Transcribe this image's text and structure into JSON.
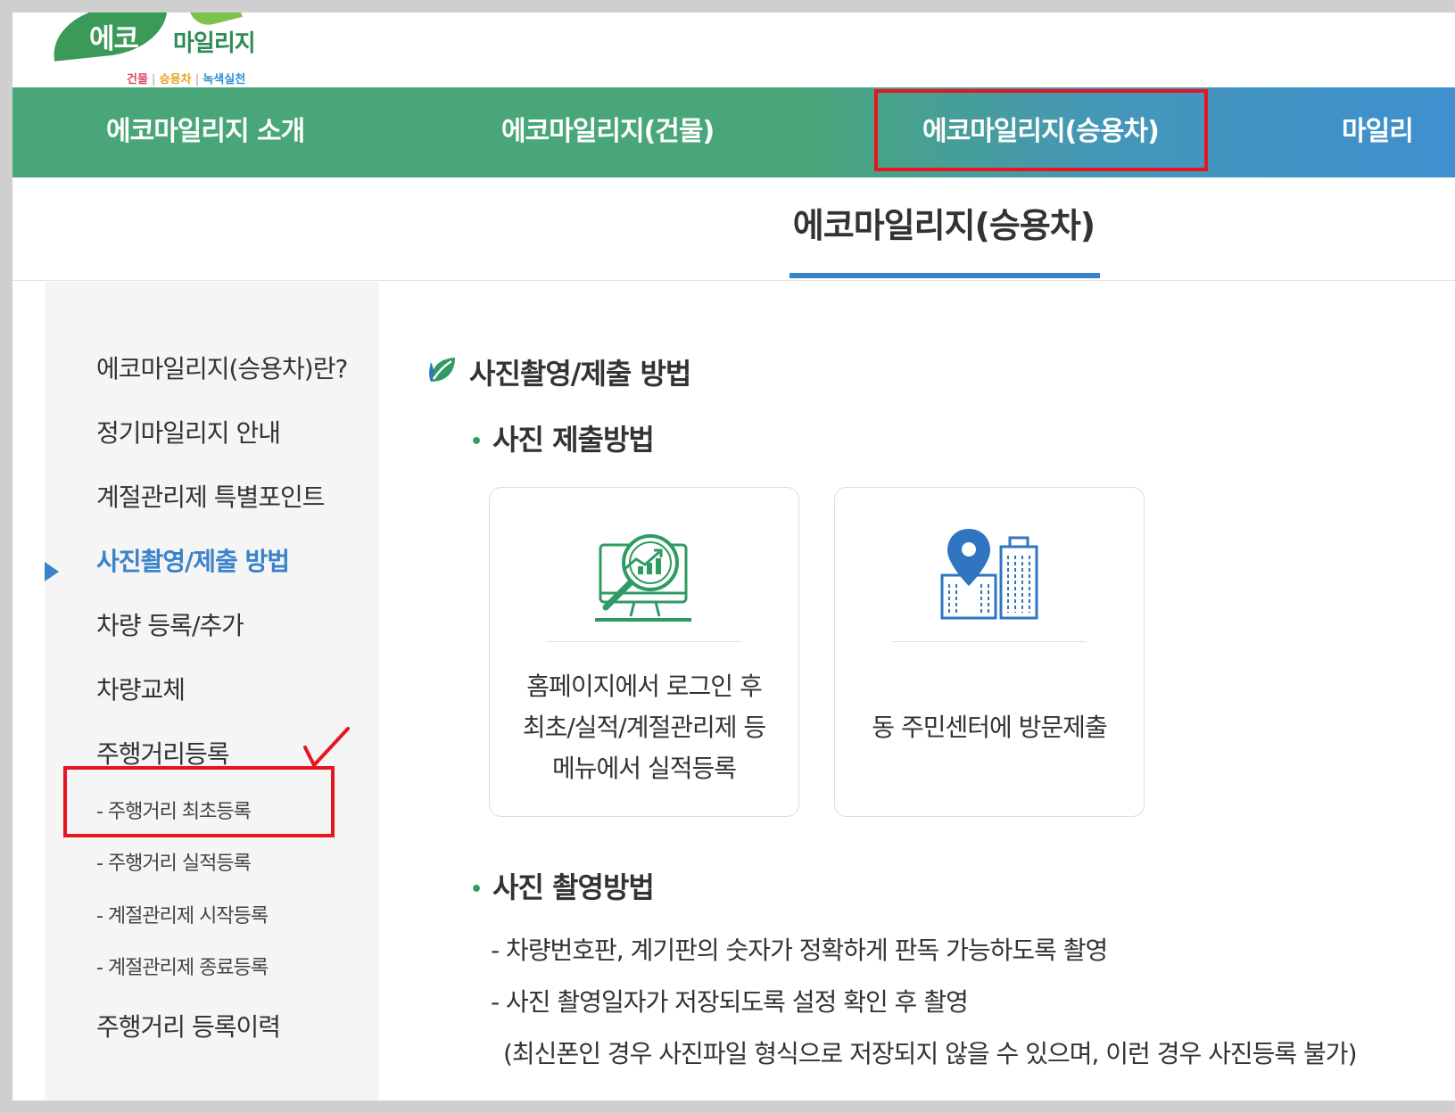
{
  "logo": {
    "brand_main": "에코",
    "brand_sub": "마일리지",
    "tagline_1": "건물",
    "tagline_2": "승용차",
    "tagline_3": "녹색실천",
    "separator": "|",
    "colors": {
      "green": "#3b9a57",
      "red": "#e14a5c",
      "orange": "#e9a21f",
      "blue": "#2b8fd6"
    }
  },
  "topnav": {
    "items": [
      {
        "label": "에코마일리지 소개"
      },
      {
        "label": "에코마일리지(건물)"
      },
      {
        "label": "에코마일리지(승용차)"
      },
      {
        "label": "마일리"
      }
    ],
    "colors": {
      "start": "#48a679",
      "end": "#3f8fd0"
    }
  },
  "page": {
    "title": "에코마일리지(승용차)",
    "accent": "#3a83c8"
  },
  "sidebar": {
    "items": [
      {
        "label": "에코마일리지(승용차)란?"
      },
      {
        "label": "정기마일리지 안내"
      },
      {
        "label": "계절관리제 특별포인트"
      },
      {
        "label": "사진촬영/제출 방법",
        "active": true
      },
      {
        "label": "차량 등록/추가"
      },
      {
        "label": "차량교체"
      },
      {
        "label": "주행거리등록"
      }
    ],
    "sub_items": [
      {
        "label": "- 주행거리 최초등록"
      },
      {
        "label": "- 주행거리 실적등록"
      },
      {
        "label": "- 계절관리제 시작등록"
      },
      {
        "label": "- 계절관리제 종료등록"
      }
    ],
    "last_item": {
      "label": "주행거리 등록이력"
    }
  },
  "content": {
    "section_title": "사진촬영/제출 방법",
    "bullet_dot": "•",
    "submit": {
      "heading": "사진 제출방법",
      "cards": [
        {
          "icon": "monitor-analytics-icon",
          "lines": [
            "홈페이지에서 로그인 후",
            "최초/실적/계절관리제 등",
            "메뉴에서 실적등록"
          ]
        },
        {
          "icon": "location-building-icon",
          "lines": [
            "동 주민센터에 방문제출"
          ]
        }
      ]
    },
    "shoot": {
      "heading": "사진 촬영방법",
      "lines": [
        "- 차량번호판, 계기판의 숫자가 정확하게 판독 가능하도록 촬영",
        "- 사진 촬영일자가 저장되도록 설정 확인 후 촬영"
      ],
      "note": "(최신폰인 경우 사진파일 형식으로 저장되지 않을 수 있으며, 이런 경우 사진등록 불가)"
    },
    "icon_colors": {
      "green": "#2e9b63",
      "blue": "#2f75c0"
    }
  },
  "annotation": {
    "color": "#e6151f"
  }
}
